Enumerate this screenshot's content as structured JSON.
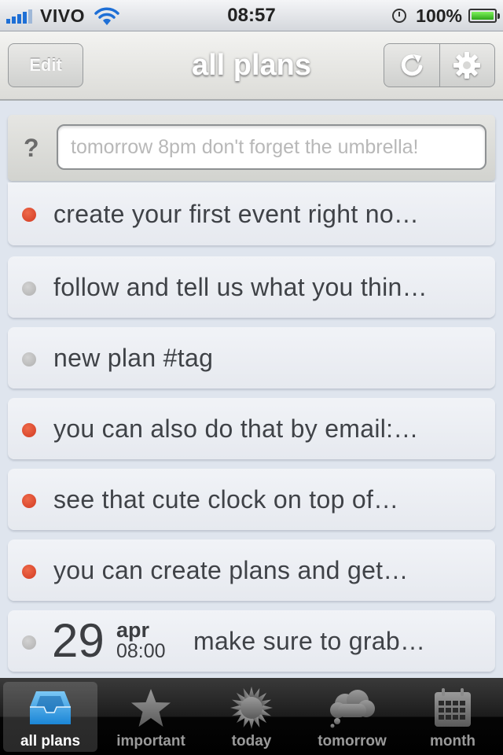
{
  "status_bar": {
    "carrier": "VIVO",
    "time": "08:57",
    "battery": "100%"
  },
  "nav": {
    "edit_label": "Edit",
    "title": "all plans"
  },
  "quick_add": {
    "help_label": "?",
    "placeholder": "tomorrow 8pm don't forget the umbrella!",
    "value": ""
  },
  "plans": [
    {
      "text": "create your first event right no…",
      "priority": "red"
    },
    {
      "text": "follow and tell us what you thin…",
      "priority": "gray"
    },
    {
      "text": "new plan #tag",
      "priority": "gray"
    },
    {
      "text": "you can also do that by email:…",
      "priority": "red"
    },
    {
      "text": "see that cute clock on top of…",
      "priority": "red"
    },
    {
      "text": "you can create plans and get…",
      "priority": "red"
    },
    {
      "text": "make sure to grab…",
      "priority": "gray",
      "day": "29",
      "month": "apr",
      "time": "08:00"
    }
  ],
  "tabs": [
    {
      "label": "all plans",
      "icon": "inbox-icon",
      "active": true
    },
    {
      "label": "important",
      "icon": "star-icon",
      "active": false
    },
    {
      "label": "today",
      "icon": "sun-icon",
      "active": false
    },
    {
      "label": "tomorrow",
      "icon": "cloud-icon",
      "active": false
    },
    {
      "label": "month",
      "icon": "calendar-icon",
      "active": false
    }
  ],
  "colors": {
    "accent_blue": "#2f9ce3",
    "priority_red": "#d9442a",
    "priority_gray": "#bdbdbd"
  }
}
